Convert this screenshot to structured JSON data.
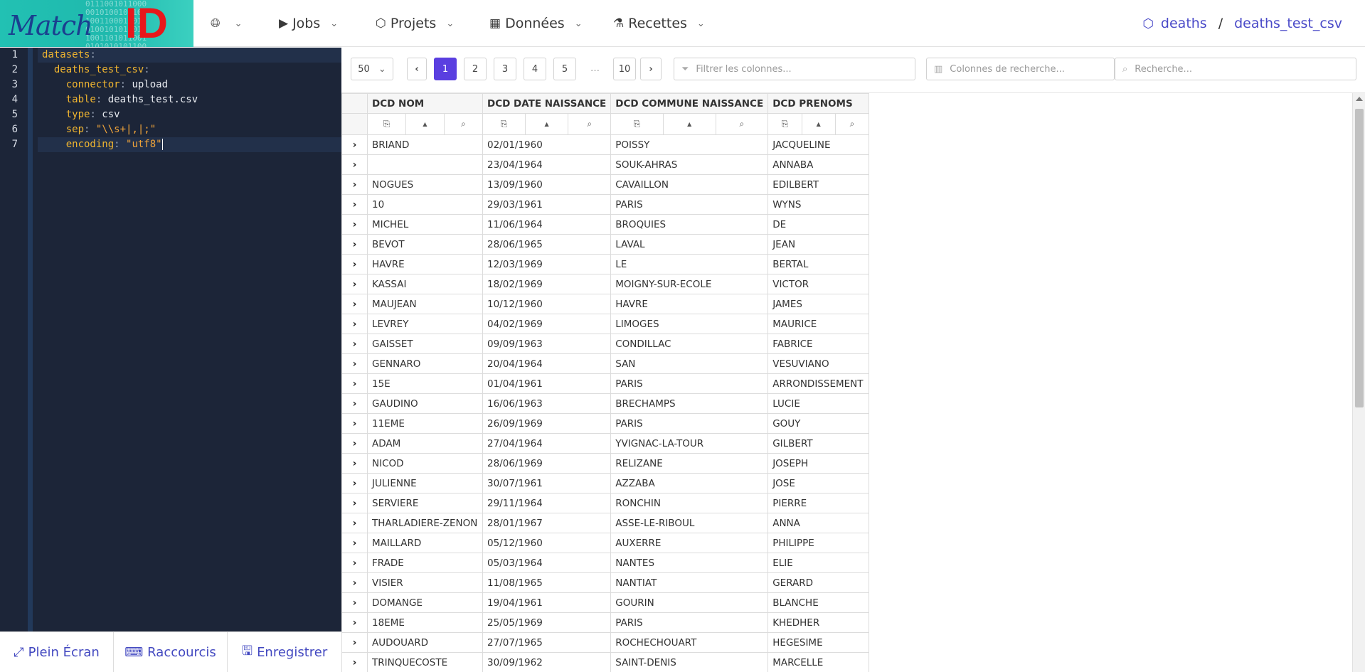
{
  "brand": {
    "logo_text_match": "Match",
    "logo_text_id": "ID",
    "logo_bits": "0111001011000\n001010010110\n1001100011011\n0100101011011\n1001101011001\n0101010101100"
  },
  "nav": {
    "globe_icon": "globe-icon",
    "jobs": "Jobs",
    "projects": "Projets",
    "data": "Données",
    "recipes": "Recettes"
  },
  "breadcrumb": {
    "project": "deaths",
    "separator": "/",
    "dataset": "deaths_test_csv"
  },
  "editor": {
    "line_numbers": [
      "1",
      "2",
      "3",
      "4",
      "5",
      "6",
      "7"
    ],
    "lines": [
      {
        "key": "datasets",
        "value": ""
      },
      {
        "key": "deaths_test_csv",
        "value": ""
      },
      {
        "key": "connector",
        "value": "upload"
      },
      {
        "key": "table",
        "value": "deaths_test.csv"
      },
      {
        "key": "type",
        "value": "csv"
      },
      {
        "key": "sep",
        "value": "\"\\\\s+|,|;\""
      },
      {
        "key": "encoding",
        "value": "\"utf8\""
      }
    ],
    "actions": {
      "fullscreen": "Plein Écran",
      "shortcuts": "Raccourcis",
      "save": "Enregistrer"
    }
  },
  "toolbar": {
    "page_size": "50",
    "pages": [
      "1",
      "2",
      "3",
      "4",
      "5"
    ],
    "ellipsis": "…",
    "last_page": "10",
    "current_page": "1",
    "filter_columns_placeholder": "Filtrer les colonnes...",
    "search_columns_placeholder": "Colonnes de recherche...",
    "search_placeholder": "Recherche..."
  },
  "table": {
    "columns": [
      "DCD NOM",
      "DCD DATE NAISSANCE",
      "DCD COMMUNE NAISSANCE",
      "DCD PRENOMS"
    ],
    "rows": [
      [
        "BRIAND",
        "02/01/1960",
        "POISSY",
        "JACQUELINE"
      ],
      [
        "",
        "23/04/1964",
        "SOUK-AHRAS",
        "ANNABA"
      ],
      [
        "NOGUES",
        "13/09/1960",
        "CAVAILLON",
        "EDILBERT"
      ],
      [
        "10",
        "29/03/1961",
        "PARIS",
        "WYNS"
      ],
      [
        "MICHEL",
        "11/06/1964",
        "BROQUIES",
        "DE"
      ],
      [
        "BEVOT",
        "28/06/1965",
        "LAVAL",
        "JEAN"
      ],
      [
        "HAVRE",
        "12/03/1969",
        "LE",
        "BERTAL"
      ],
      [
        "KASSAI",
        "18/02/1969",
        "MOIGNY-SUR-ECOLE",
        "VICTOR"
      ],
      [
        "MAUJEAN",
        "10/12/1960",
        "HAVRE",
        "JAMES"
      ],
      [
        "LEVREY",
        "04/02/1969",
        "LIMOGES",
        "MAURICE"
      ],
      [
        "GAISSET",
        "09/09/1963",
        "CONDILLAC",
        "FABRICE"
      ],
      [
        "GENNARO",
        "20/04/1964",
        "SAN",
        "VESUVIANO"
      ],
      [
        "15E",
        "01/04/1961",
        "PARIS",
        "ARRONDISSEMENT"
      ],
      [
        "GAUDINO",
        "16/06/1963",
        "BRECHAMPS",
        "LUCIE"
      ],
      [
        "11EME",
        "26/09/1969",
        "PARIS",
        "GOUY"
      ],
      [
        "ADAM",
        "27/04/1964",
        "YVIGNAC-LA-TOUR",
        "GILBERT"
      ],
      [
        "NICOD",
        "28/06/1969",
        "RELIZANE",
        "JOSEPH"
      ],
      [
        "JULIENNE",
        "30/07/1961",
        "AZZABA",
        "JOSE"
      ],
      [
        "SERVIERE",
        "29/11/1964",
        "RONCHIN",
        "PIERRE"
      ],
      [
        "THARLADIERE-ZENON",
        "28/01/1967",
        "ASSE-LE-RIBOUL",
        "ANNA"
      ],
      [
        "MAILLARD",
        "05/12/1960",
        "AUXERRE",
        "PHILIPPE"
      ],
      [
        "FRADE",
        "05/03/1964",
        "NANTES",
        "ELIE"
      ],
      [
        "VISIER",
        "11/08/1965",
        "NANTIAT",
        "GERARD"
      ],
      [
        "DOMANGE",
        "19/04/1961",
        "GOURIN",
        "BLANCHE"
      ],
      [
        "18EME",
        "25/05/1969",
        "PARIS",
        "KHEDHER"
      ],
      [
        "AUDOUARD",
        "27/07/1965",
        "ROCHECHOUART",
        "HEGESIME"
      ],
      [
        "TRINQUECOSTE",
        "30/09/1962",
        "SAINT-DENIS",
        "MARCELLE"
      ]
    ]
  },
  "colors": {
    "accent": "#5a3fe0",
    "link": "#4a4ac8",
    "editor_bg": "#1c2538",
    "yaml_key": "#f0b530"
  }
}
